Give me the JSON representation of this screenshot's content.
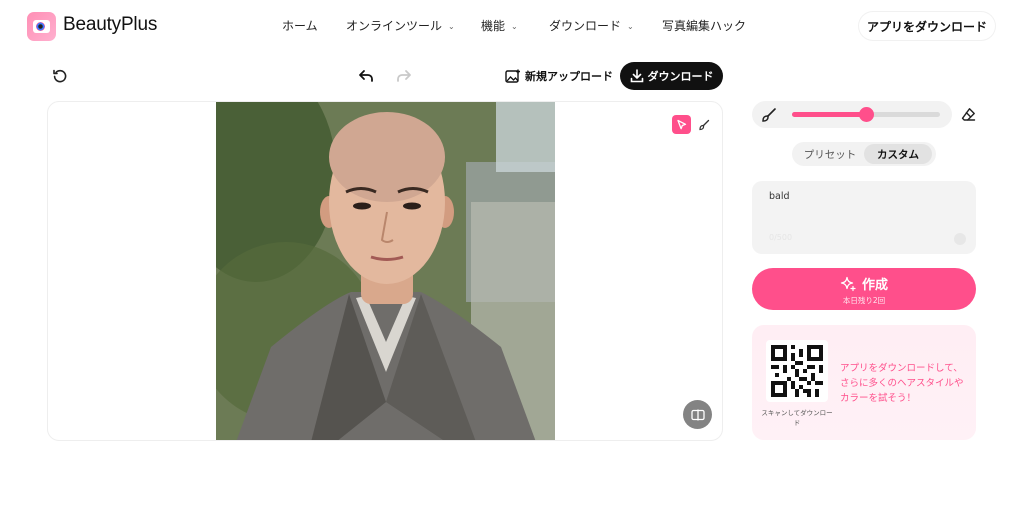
{
  "brand": {
    "name": "BeautyPlus",
    "accent": "#ff4f8b"
  },
  "nav": {
    "items": [
      {
        "label": "ホーム",
        "has_dropdown": false
      },
      {
        "label": "オンラインツール",
        "has_dropdown": true
      },
      {
        "label": "機能",
        "has_dropdown": true
      },
      {
        "label": "ダウンロード",
        "has_dropdown": true
      },
      {
        "label": "写真編集ハック",
        "has_dropdown": false
      }
    ],
    "cta": "アプリをダウンロード"
  },
  "toolbar": {
    "new_upload": "新規アップロード",
    "download": "ダウンロード",
    "icons": [
      "reset-icon",
      "undo-icon",
      "redo-icon"
    ]
  },
  "canvas": {
    "tools": [
      "select-tool-icon",
      "brush-tool-icon"
    ],
    "compare_icon": "compare-icon"
  },
  "panel": {
    "brush_size": 0.5,
    "segments": {
      "preset": "プリセット",
      "custom": "カスタム",
      "selected": "custom"
    },
    "prompt_value": "bald",
    "prompt_sub": "0/500",
    "create_label": "作成",
    "create_sub": "本日残り2回",
    "promo_text": "アプリをダウンロードして、さらに多くのヘアスタイルやカラーを試そう！",
    "qr_caption": "スキャンしてダウンロード"
  }
}
